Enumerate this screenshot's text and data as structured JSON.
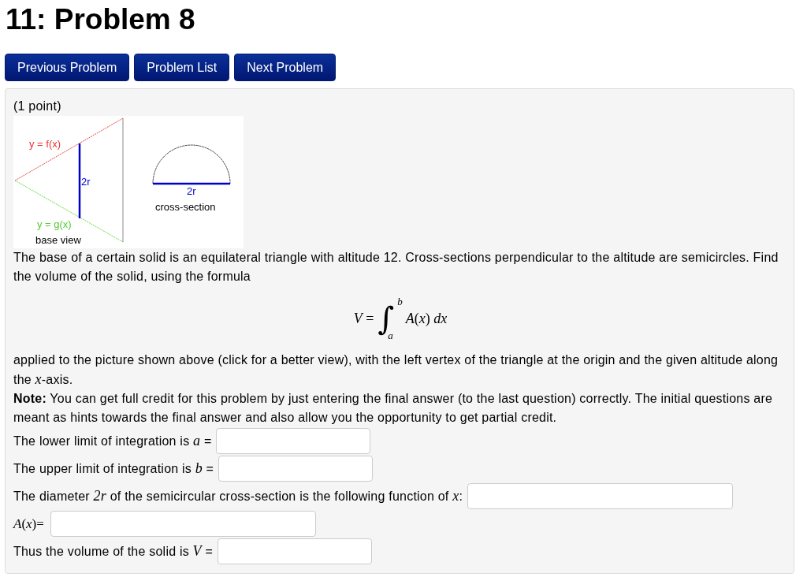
{
  "title": "11: Problem 8",
  "nav_buttons": [
    "Previous Problem",
    "Problem List",
    "Next Problem"
  ],
  "problem": {
    "points": "(1 point)",
    "figure": {
      "base_view": {
        "upper_curve": "y = f(x)",
        "chord": "2r",
        "lower_curve": "y = g(x)",
        "caption": "base view"
      },
      "cross_section": {
        "diameter": "2r",
        "caption": "cross-section"
      }
    },
    "statement": "The base of a certain solid is an equilateral triangle with altitude 12. Cross-sections perpendicular to the altitude are semicircles. Find the volume of the solid, using the formula",
    "formula": {
      "lhs": "*V* =",
      "sign": "∫",
      "upper": "b",
      "lower": "a",
      "integrand": "*A*(*x*) *dx*"
    },
    "context": "applied to the picture shown above (click for a better view), with the left vertex of the triangle at the origin and the given altitude along the *x*-axis.",
    "note": "**Note:** You can get full credit for this problem by just entering the final answer (to the last question) correctly. The initial questions are meant as hints towards the final answer and also allow you the opportunity to get partial credit.",
    "questions": [
      {
        "text": "The lower limit of integration is *a* =",
        "kind": "text",
        "wide": false
      },
      {
        "text": "The upper limit of integration is *b* =",
        "kind": "text",
        "wide": false
      },
      {
        "text": "The diameter *2r* of the semicircular cross-section is the following function of *x*:",
        "kind": "text",
        "wide": true
      },
      {
        "text": "*A*(*x*)=",
        "kind": "math",
        "wide": true
      },
      {
        "text": "Thus the volume of the solid is *V* =",
        "kind": "text",
        "wide": false
      }
    ]
  }
}
